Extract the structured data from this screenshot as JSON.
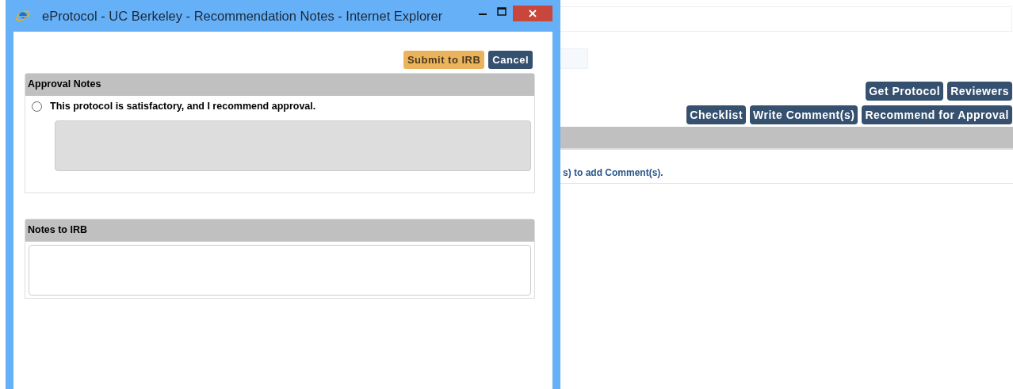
{
  "background_page": {
    "toolbar_row_1": [
      "Get Protocol",
      "Reviewers"
    ],
    "toolbar_row_2": [
      "Checklist",
      "Write Comment(s)",
      "Recommend for Approval"
    ],
    "message": "s) to add Comment(s)."
  },
  "window": {
    "title": "eProtocol - UC Berkeley - Recommendation Notes - Internet Explorer",
    "actions": [
      {
        "label": "Submit to IRB",
        "kind": "primary"
      },
      {
        "label": "Cancel",
        "kind": "secondary"
      }
    ],
    "approval_notes": {
      "heading": "Approval Notes",
      "option": {
        "label": "This protocol is satisfactory, and I recommend approval.",
        "selected": false
      }
    },
    "notes_to_irb": {
      "heading": "Notes to IRB"
    }
  }
}
